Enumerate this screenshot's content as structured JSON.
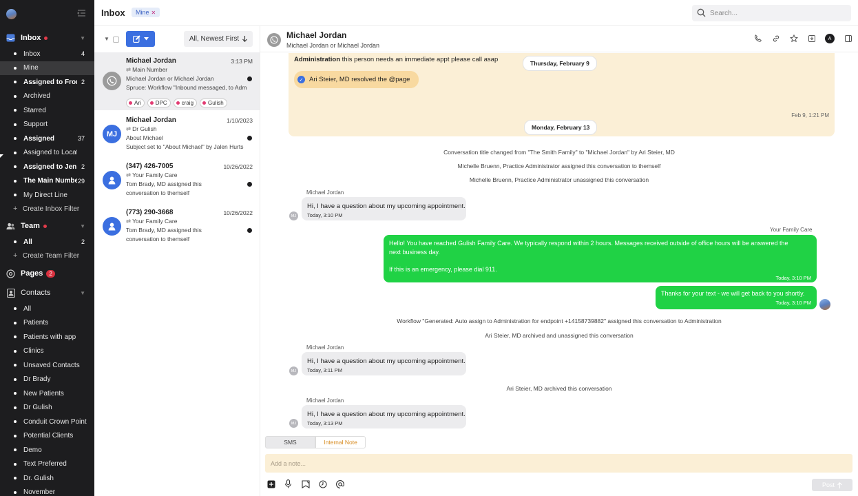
{
  "sidebar": {
    "sections": {
      "inbox": {
        "label": "Inbox"
      },
      "team": {
        "label": "Team"
      },
      "pages": {
        "label": "Pages",
        "badge": "2"
      },
      "contacts": {
        "label": "Contacts"
      }
    },
    "inbox_items": [
      {
        "label": "Inbox",
        "count": "4",
        "bold": false
      },
      {
        "label": "Mine",
        "count": "",
        "bold": false,
        "active": true
      },
      {
        "label": "Assigned to Front Desk",
        "count": "2",
        "bold": true
      },
      {
        "label": "Archived",
        "count": "",
        "bold": false
      },
      {
        "label": "Starred",
        "count": "",
        "bold": false
      },
      {
        "label": "Support",
        "count": "",
        "bold": false
      },
      {
        "label": "Assigned",
        "count": "37",
        "bold": true
      },
      {
        "label": "Assigned to Location",
        "count": "",
        "bold": false
      },
      {
        "label": "Assigned to Jen",
        "count": "2",
        "bold": true
      },
      {
        "label": "The Main Number",
        "count": "29",
        "bold": true
      },
      {
        "label": "My Direct Line",
        "count": "",
        "bold": false
      }
    ],
    "create_inbox_filter": "Create Inbox Filter",
    "team_items": [
      {
        "label": "All",
        "count": "2",
        "bold": true
      }
    ],
    "create_team_filter": "Create Team Filter",
    "contact_items": [
      "All",
      "Patients",
      "Patients with app",
      "Clinics",
      "Unsaved Contacts",
      "Dr Brady",
      "New Patients",
      "Dr Gulish",
      "Conduit Crown Point",
      "Potential Clients",
      "Demo",
      "Text Preferred",
      "Dr. Gulish",
      "November"
    ]
  },
  "topbar": {
    "title": "Inbox",
    "filter_chip": "Mine",
    "search_placeholder": "Search..."
  },
  "list": {
    "sort_label": "All, Newest First",
    "conversations": [
      {
        "name": "Michael Jordan",
        "date": "3:13 PM",
        "sub": "Main Number",
        "line1": "Michael Jordan or Michael Jordan",
        "line2": "Spruce: Workflow \"Inbound messaged, to Administration\"",
        "avatar_color": "#9b9b9b",
        "initials": "",
        "tags": [
          "Ari",
          "DPC",
          "craig",
          "Gulish"
        ]
      },
      {
        "name": "Michael Jordan",
        "date": "1/10/2023",
        "sub": "Dr Gulish",
        "line1": "About Michael",
        "line2": "Subject set to \"About Michael\" by Jalen Hurts",
        "avatar_color": "#3b6fe0",
        "initials": "MJ"
      },
      {
        "name": "(347) 426-7005",
        "date": "10/26/2022",
        "sub": "Your Family Care",
        "line1": "Tom Brady, MD assigned this",
        "line2": "conversation to themself",
        "avatar_color": "#3b6fe0",
        "initials": ""
      },
      {
        "name": "(773) 290-3668",
        "date": "10/26/2022",
        "sub": "Your Family Care",
        "line1": "Tom Brady, MD assigned this",
        "line2": "conversation to themself",
        "avatar_color": "#3b6fe0",
        "initials": ""
      }
    ]
  },
  "chat": {
    "header": {
      "name": "Michael Jordan",
      "subtitle": "Michael Jordan or Michael Jordan",
      "account_initial": "A"
    },
    "note": {
      "author": "Administration",
      "text": " this person needs an immediate appt please call asap",
      "resolved": "Ari Steier, MD resolved the @page",
      "time": "Feb 9, 1:21 PM"
    },
    "date_pills": [
      "Thursday, February 9",
      "Monday, February 13"
    ],
    "system_messages": [
      "Conversation title changed from \"The Smith Family\" to \"Michael Jordan\" by Ari Steier, MD",
      "Michelle Bruenn, Practice Administrator assigned this conversation to themself",
      "Michelle Bruenn, Practice Administrator unassigned this conversation",
      "Workflow \"Generated: Auto assign to Administration for endpoint +14158739882\" assigned this conversation to Administration",
      "Ari Steier, MD archived and unassigned this conversation",
      "Ari Steier, MD archived this conversation"
    ],
    "incoming": [
      {
        "sender": "Michael Jordan",
        "text": "Hi, I have a question about my upcoming appointment.",
        "time": "Today, 3:10 PM",
        "initials": "MJ"
      },
      {
        "sender": "Michael Jordan",
        "text": "Hi, I have a question about my upcoming appointment.",
        "time": "Today, 3:11 PM",
        "initials": "MJ"
      },
      {
        "sender": "Michael Jordan",
        "text": "Hi, I have a question about my upcoming appointment.",
        "time": "Today, 3:13 PM",
        "initials": "MJ"
      }
    ],
    "outgoing": [
      {
        "sender": "Your Family Care",
        "line1": "Hello! You have reached Gulish Family Care. We typically respond within 2 hours. Messages received outside of office hours will be answered the",
        "line2": "next business day.",
        "line3": "If this is an emergency, please dial 911.",
        "time": "Today, 3:10 PM"
      },
      {
        "text": "Thanks for your text - we will get back to you shortly.",
        "time": "Today, 3:10 PM"
      }
    ]
  },
  "composer": {
    "tab_sms": "SMS",
    "tab_note": "Internal Note",
    "placeholder": "Add a note...",
    "post_label": "Post"
  },
  "colors": {
    "accent": "#3b6fe0",
    "outgoing": "#20d245",
    "note": "#fbefd6",
    "sidebar": "#1d1d1f",
    "alert": "#e23b4a"
  }
}
